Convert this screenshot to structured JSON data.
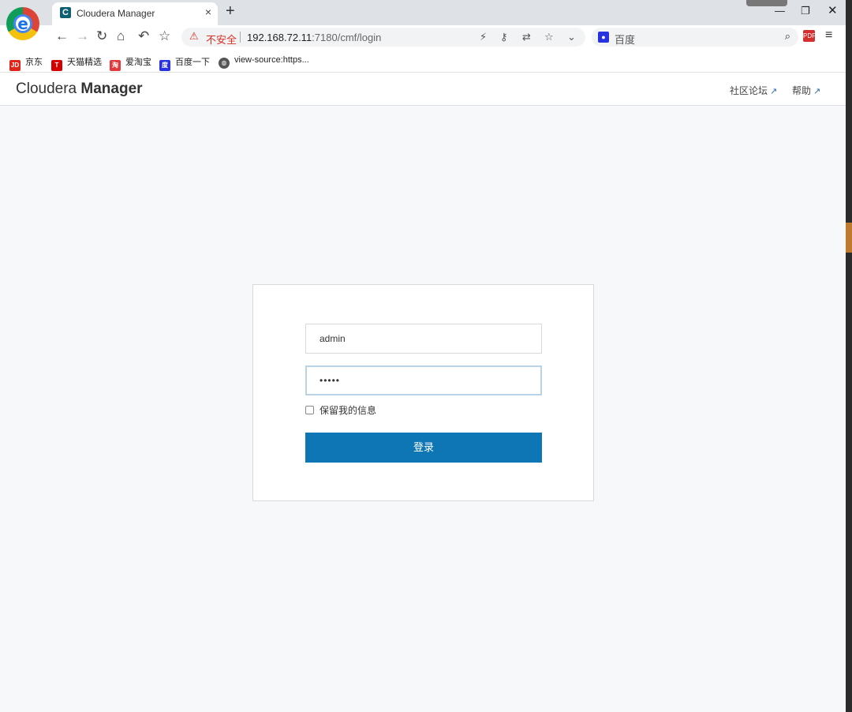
{
  "browser": {
    "tab": {
      "favicon": "C",
      "title": "Cloudera Manager",
      "close": "×"
    },
    "new_tab": "+",
    "window": {
      "minimize": "—",
      "restore": "❐",
      "close": "✕"
    },
    "nav": {
      "back": "←",
      "forward": "→",
      "reload": "↻",
      "home": "⌂",
      "undo": "↶",
      "favorite": "☆"
    },
    "address": {
      "warning_icon": "⚠",
      "security_label": "不安全",
      "url_host": "192.168.72.11",
      "url_path": ":7180/cmf/login"
    },
    "omni_icons": {
      "lightning": "⚡",
      "key": "⚷",
      "translate": "⇄",
      "star": "☆",
      "dropdown": "⌄"
    },
    "search": {
      "engine_icon": "🐾",
      "placeholder": "百度",
      "icon": "⌕"
    },
    "pdf_icon": "PDF",
    "menu_icon": "≡",
    "bookmarks": [
      {
        "icon": "JD",
        "label": "京东",
        "color": "#e1251b"
      },
      {
        "icon": "T",
        "label": "天猫精选",
        "color": "#d40000"
      },
      {
        "icon": "淘",
        "label": "爱淘宝",
        "color": "#e4393c"
      },
      {
        "icon": "度",
        "label": "百度一下",
        "color": "#2932e1"
      },
      {
        "icon": "◍",
        "label": "view-source:https...",
        "color": "#555555"
      }
    ]
  },
  "app": {
    "brand_light": "Cloudera",
    "brand_bold": "Manager",
    "links": {
      "community": "社区论坛",
      "help": "帮助",
      "external_icon": "↗"
    }
  },
  "login": {
    "username_value": "admin",
    "password_value": "•••••",
    "remember_label": "保留我的信息",
    "submit_label": "登录",
    "accent_color": "#0e76b5"
  }
}
